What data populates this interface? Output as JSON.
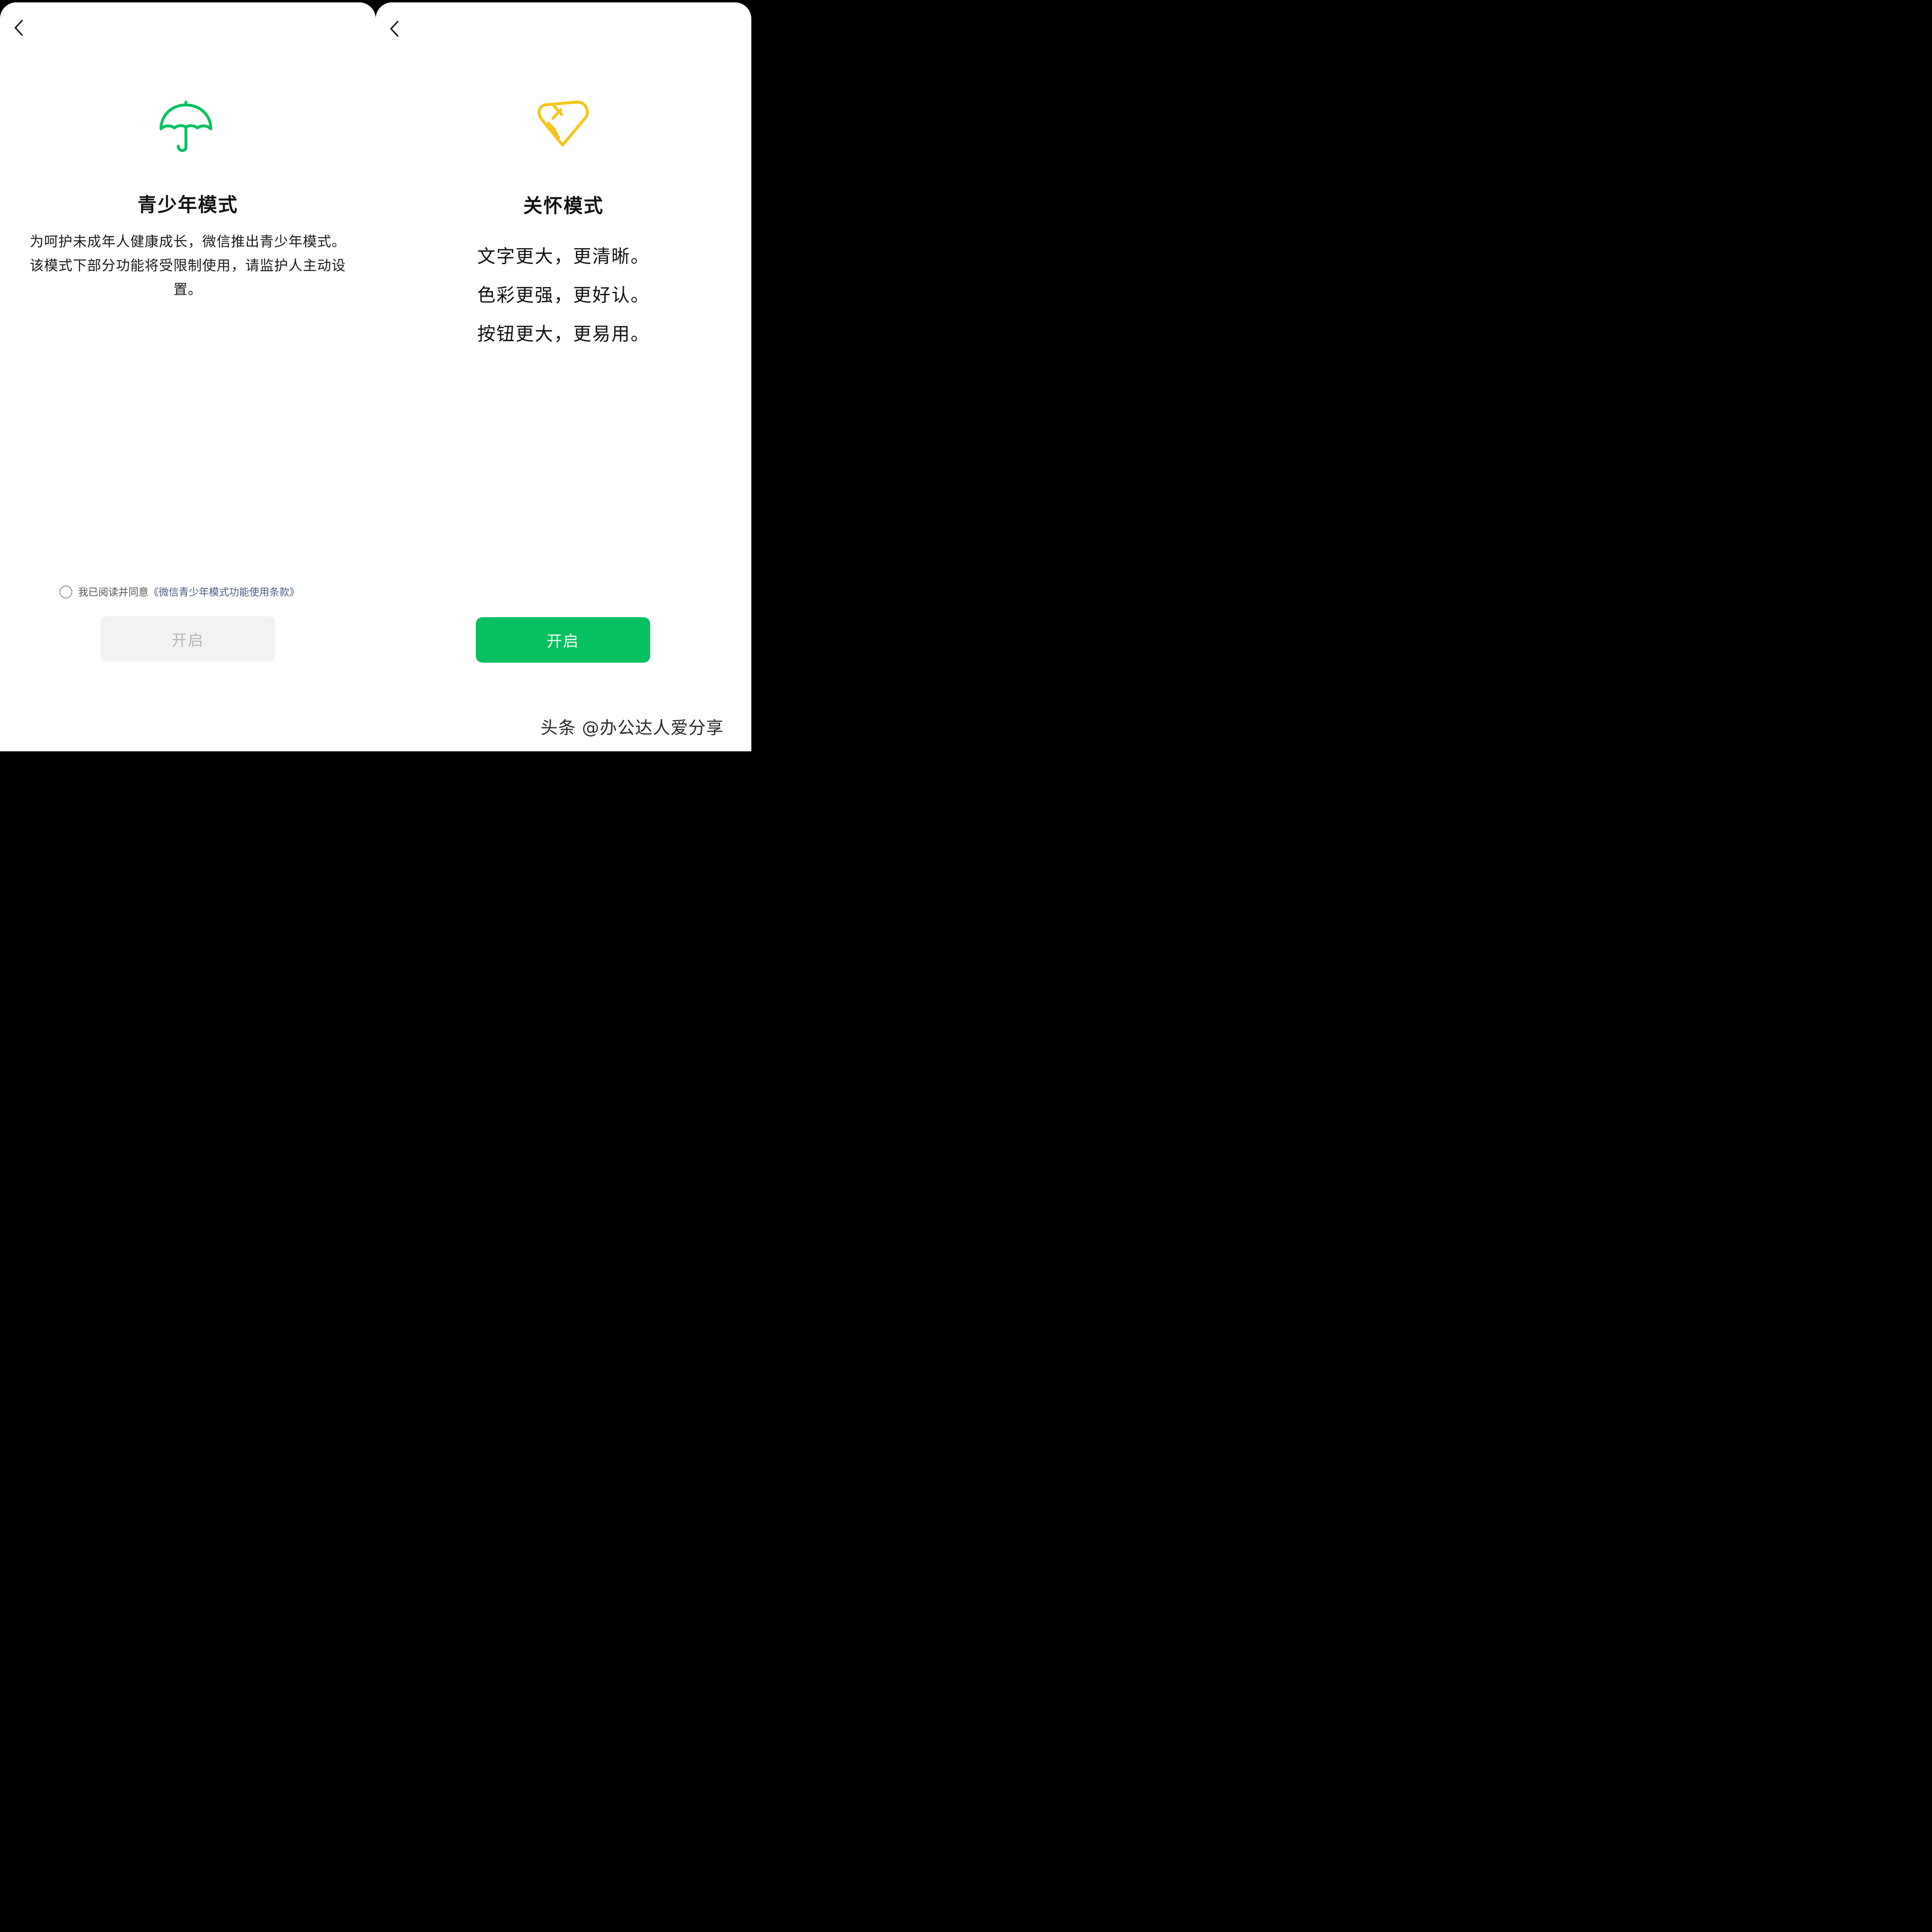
{
  "colors": {
    "accent_green": "#07c160",
    "icon_yellow": "#f5c518",
    "link_blue": "#4a5d85",
    "disabled_bg": "#f2f2f2",
    "disabled_text": "#b6b6b6"
  },
  "left_screen": {
    "back_icon": "chevron-left-icon",
    "icon": "umbrella-icon",
    "title": "青少年模式",
    "description": "为呵护未成年人健康成长，微信推出青少年模式。该模式下部分功能将受限制使用，请监护人主动设置。",
    "agreement": {
      "prefix": "我已阅读并同意",
      "link": "《微信青少年模式功能使用条款》",
      "checked": false
    },
    "enable_button": "开启",
    "enable_button_state": "disabled"
  },
  "right_screen": {
    "back_icon": "chevron-left-icon",
    "icon": "care-hands-heart-icon",
    "title": "关怀模式",
    "features": [
      "文字更大，更清晰。",
      "色彩更强，更好认。",
      "按钮更大，更易用。"
    ],
    "enable_button": "开启",
    "enable_button_state": "enabled"
  },
  "watermark": "头条 @办公达人爱分享"
}
